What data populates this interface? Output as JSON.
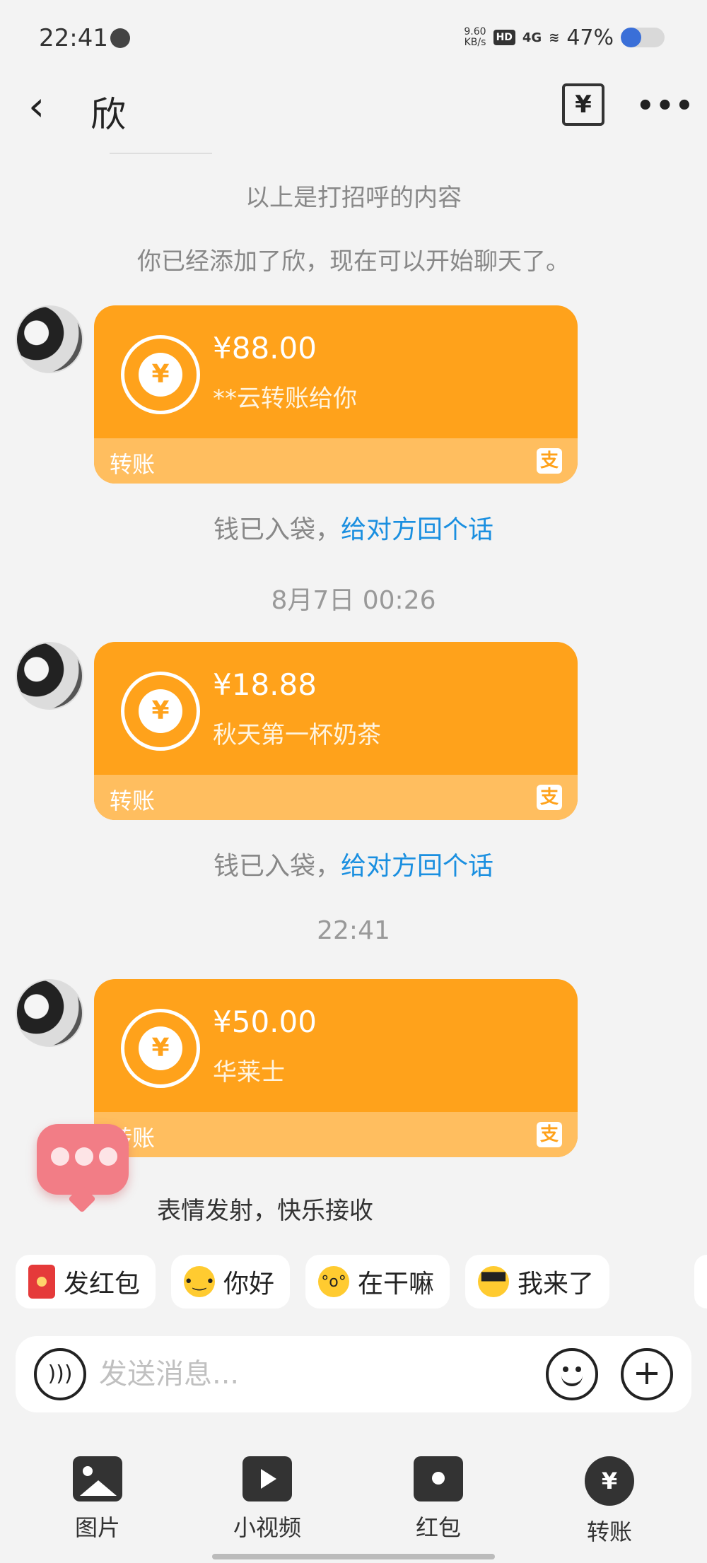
{
  "status_bar": {
    "time": "22:41",
    "speed": "9.60",
    "speed_unit": "KB/s",
    "hd": "HD",
    "signal": "4G",
    "battery_pct": "47%",
    "battery_level": 0.47
  },
  "header": {
    "back_icon": "chevron-left-icon",
    "contact_name": "欣",
    "bill_icon_glyph": "¥",
    "more_icon_glyph": "•••"
  },
  "system": {
    "greeting_note": "以上是打招呼的内容",
    "added_note": "你已经添加了欣，现在可以开始聊天了。"
  },
  "messages": [
    {
      "amount": "¥88.00",
      "memo": "**云转账给你",
      "footer_label": "转账",
      "receipt_text": "钱已入袋，",
      "reply_link": "给对方回个话"
    },
    {
      "timestamp": "8月7日 00:26",
      "amount": "¥18.88",
      "memo": "秋天第一杯奶茶",
      "footer_label": "转账",
      "receipt_text": "钱已入袋，",
      "reply_link": "给对方回个话"
    },
    {
      "timestamp": "22:41",
      "amount": "¥50.00",
      "memo": "华莱士",
      "footer_label": "转账"
    }
  ],
  "transfer_glyph": "¥",
  "alipay_glyph": "支",
  "emoji_tip": "表情发射，快乐接收",
  "quick_replies": [
    {
      "label": "发红包",
      "icon": "red-packet-icon"
    },
    {
      "label": "你好",
      "icon": "thinking-emoji-icon"
    },
    {
      "label": "在干嘛",
      "icon": "curious-emoji-icon"
    },
    {
      "label": "我来了",
      "icon": "cool-emoji-icon"
    }
  ],
  "input": {
    "placeholder": "发送消息...",
    "value": ""
  },
  "toolbar": [
    {
      "label": "图片",
      "icon": "image-icon"
    },
    {
      "label": "小视频",
      "icon": "video-icon"
    },
    {
      "label": "红包",
      "icon": "red-packet-icon"
    },
    {
      "label": "转账",
      "icon": "transfer-icon"
    }
  ],
  "colors": {
    "card_orange": "#ffa21b",
    "card_footer": "#ffbe5f",
    "link_blue": "#1a8fe0",
    "background": "#f3f3f3"
  }
}
